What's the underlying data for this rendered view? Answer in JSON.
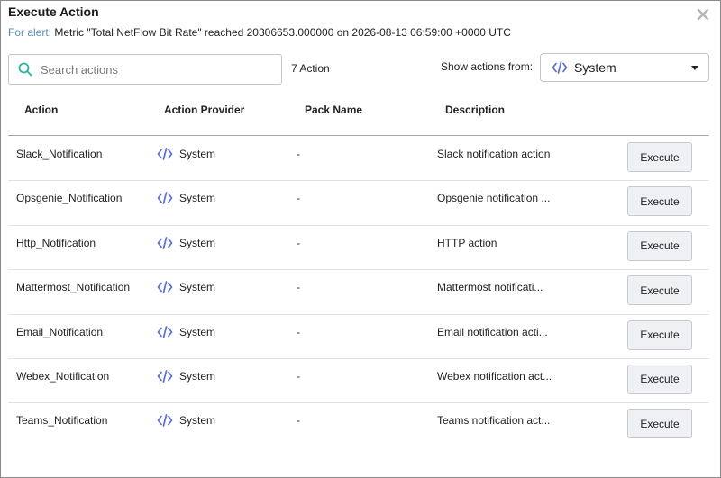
{
  "dialog": {
    "title": "Execute Action",
    "alert_prefix": "For alert:",
    "alert_text": "Metric \"Total NetFlow Bit Rate\" reached 20306653.000000 on 2026-08-13 06:59:00 +0000 UTC"
  },
  "toolbar": {
    "search_placeholder": "Search actions",
    "search_value": "",
    "action_count": "7 Action",
    "show_from_label": "Show actions from:",
    "source_selected": "System"
  },
  "table": {
    "headers": {
      "action": "Action",
      "provider": "Action Provider",
      "pack": "Pack Name",
      "description": "Description"
    },
    "execute_label": "Execute",
    "rows": [
      {
        "action": "Slack_Notification",
        "provider": "System",
        "pack": "-",
        "description": "Slack notification action"
      },
      {
        "action": "Opsgenie_Notification",
        "provider": "System",
        "pack": "-",
        "description": "Opsgenie notification ..."
      },
      {
        "action": "Http_Notification",
        "provider": "System",
        "pack": "-",
        "description": "HTTP action"
      },
      {
        "action": "Mattermost_Notification",
        "provider": "System",
        "pack": "-",
        "description": "Mattermost notificati..."
      },
      {
        "action": "Email_Notification",
        "provider": "System",
        "pack": "-",
        "description": "Email notification acti..."
      },
      {
        "action": "Webex_Notification",
        "provider": "System",
        "pack": "-",
        "description": "Webex notification act..."
      },
      {
        "action": "Teams_Notification",
        "provider": "System",
        "pack": "-",
        "description": "Teams notification act..."
      }
    ]
  },
  "icons": {
    "close": "close-icon",
    "search": "search-icon",
    "provider": "code-icon",
    "dropdown": "chevron-down-icon"
  },
  "colors": {
    "accent_teal": "#2bb3a3",
    "code_icon": "#5b6fd6",
    "alert_prefix": "#5b8bb8",
    "button_bg": "#eef0f4"
  }
}
